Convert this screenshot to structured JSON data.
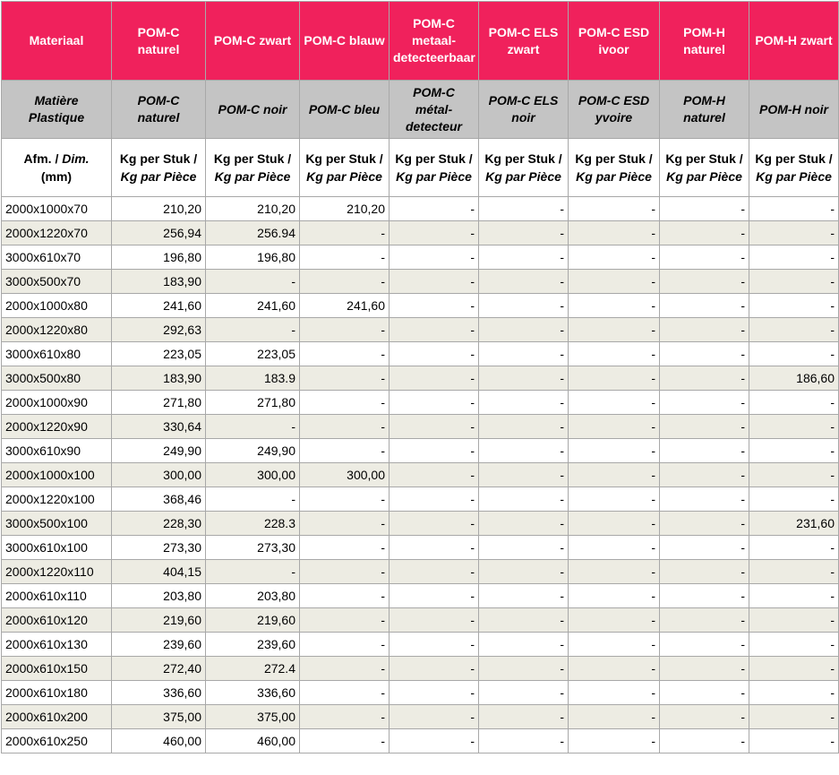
{
  "table": {
    "header_nl": [
      "Materiaal",
      "POM-C naturel",
      "POM-C zwart",
      "POM-C blauw",
      "POM-C metaal-detecteerbaar",
      "POM-C ELS zwart",
      "POM-C ESD ivoor",
      "POM-H naturel",
      "POM-H zwart"
    ],
    "header_fr": [
      "Matière Plastique",
      "POM-C naturel",
      "POM-C noir",
      "POM-C bleu",
      "POM-C métal-detecteur",
      "POM-C ELS noir",
      "POM-C ESD yvoire",
      "POM-H naturel",
      "POM-H noir"
    ],
    "header_units": {
      "dim_nl": "Afm. / ",
      "dim_fr": "Dim.",
      "dim_unit": "(mm)",
      "weight_nl": "Kg per Stuk / ",
      "weight_fr": "Kg par Pièce"
    },
    "rows": [
      [
        "2000x1000x70",
        "210,20",
        "210,20",
        "210,20",
        "-",
        "-",
        "-",
        "-",
        "-"
      ],
      [
        "2000x1220x70",
        "256,94",
        "256.94",
        "-",
        "-",
        "-",
        "-",
        "-",
        "-"
      ],
      [
        "3000x610x70",
        "196,80",
        "196,80",
        "-",
        "-",
        "-",
        "-",
        "-",
        "-"
      ],
      [
        "3000x500x70",
        "183,90",
        "-",
        "-",
        "-",
        "-",
        "-",
        "-",
        "-"
      ],
      [
        "2000x1000x80",
        "241,60",
        "241,60",
        "241,60",
        "-",
        "-",
        "-",
        "-",
        "-"
      ],
      [
        "2000x1220x80",
        "292,63",
        "-",
        "-",
        "-",
        "-",
        "-",
        "-",
        "-"
      ],
      [
        "3000x610x80",
        "223,05",
        "223,05",
        "-",
        "-",
        "-",
        "-",
        "-",
        "-"
      ],
      [
        "3000x500x80",
        "183,90",
        "183.9",
        "-",
        "-",
        "-",
        "-",
        "-",
        "186,60"
      ],
      [
        "2000x1000x90",
        "271,80",
        "271,80",
        "-",
        "-",
        "-",
        "-",
        "-",
        "-"
      ],
      [
        "2000x1220x90",
        "330,64",
        "-",
        "-",
        "-",
        "-",
        "-",
        "-",
        "-"
      ],
      [
        "3000x610x90",
        "249,90",
        "249,90",
        "-",
        "-",
        "-",
        "-",
        "-",
        "-"
      ],
      [
        "2000x1000x100",
        "300,00",
        "300,00",
        "300,00",
        "-",
        "-",
        "-",
        "-",
        "-"
      ],
      [
        "2000x1220x100",
        "368,46",
        "-",
        "-",
        "-",
        "-",
        "-",
        "-",
        "-"
      ],
      [
        "3000x500x100",
        "228,30",
        "228.3",
        "-",
        "-",
        "-",
        "-",
        "-",
        "231,60"
      ],
      [
        "3000x610x100",
        "273,30",
        "273,30",
        "-",
        "-",
        "-",
        "-",
        "-",
        "-"
      ],
      [
        "2000x1220x110",
        "404,15",
        "-",
        "-",
        "-",
        "-",
        "-",
        "-",
        "-"
      ],
      [
        "2000x610x110",
        "203,80",
        "203,80",
        "-",
        "-",
        "-",
        "-",
        "-",
        "-"
      ],
      [
        "2000x610x120",
        "219,60",
        "219,60",
        "-",
        "-",
        "-",
        "-",
        "-",
        "-"
      ],
      [
        "2000x610x130",
        "239,60",
        "239,60",
        "-",
        "-",
        "-",
        "-",
        "-",
        "-"
      ],
      [
        "2000x610x150",
        "272,40",
        "272.4",
        "-",
        "-",
        "-",
        "-",
        "-",
        "-"
      ],
      [
        "2000x610x180",
        "336,60",
        "336,60",
        "-",
        "-",
        "-",
        "-",
        "-",
        "-"
      ],
      [
        "2000x610x200",
        "375,00",
        "375,00",
        "-",
        "-",
        "-",
        "-",
        "-",
        "-"
      ],
      [
        "2000x610x250",
        "460,00",
        "460,00",
        "-",
        "-",
        "-",
        "-",
        "-",
        "-"
      ]
    ]
  },
  "colors": {
    "header_accent": "#f0215c",
    "header_secondary": "#c4c4c4",
    "stripe": "#edece3",
    "border": "#a8a8a8"
  }
}
